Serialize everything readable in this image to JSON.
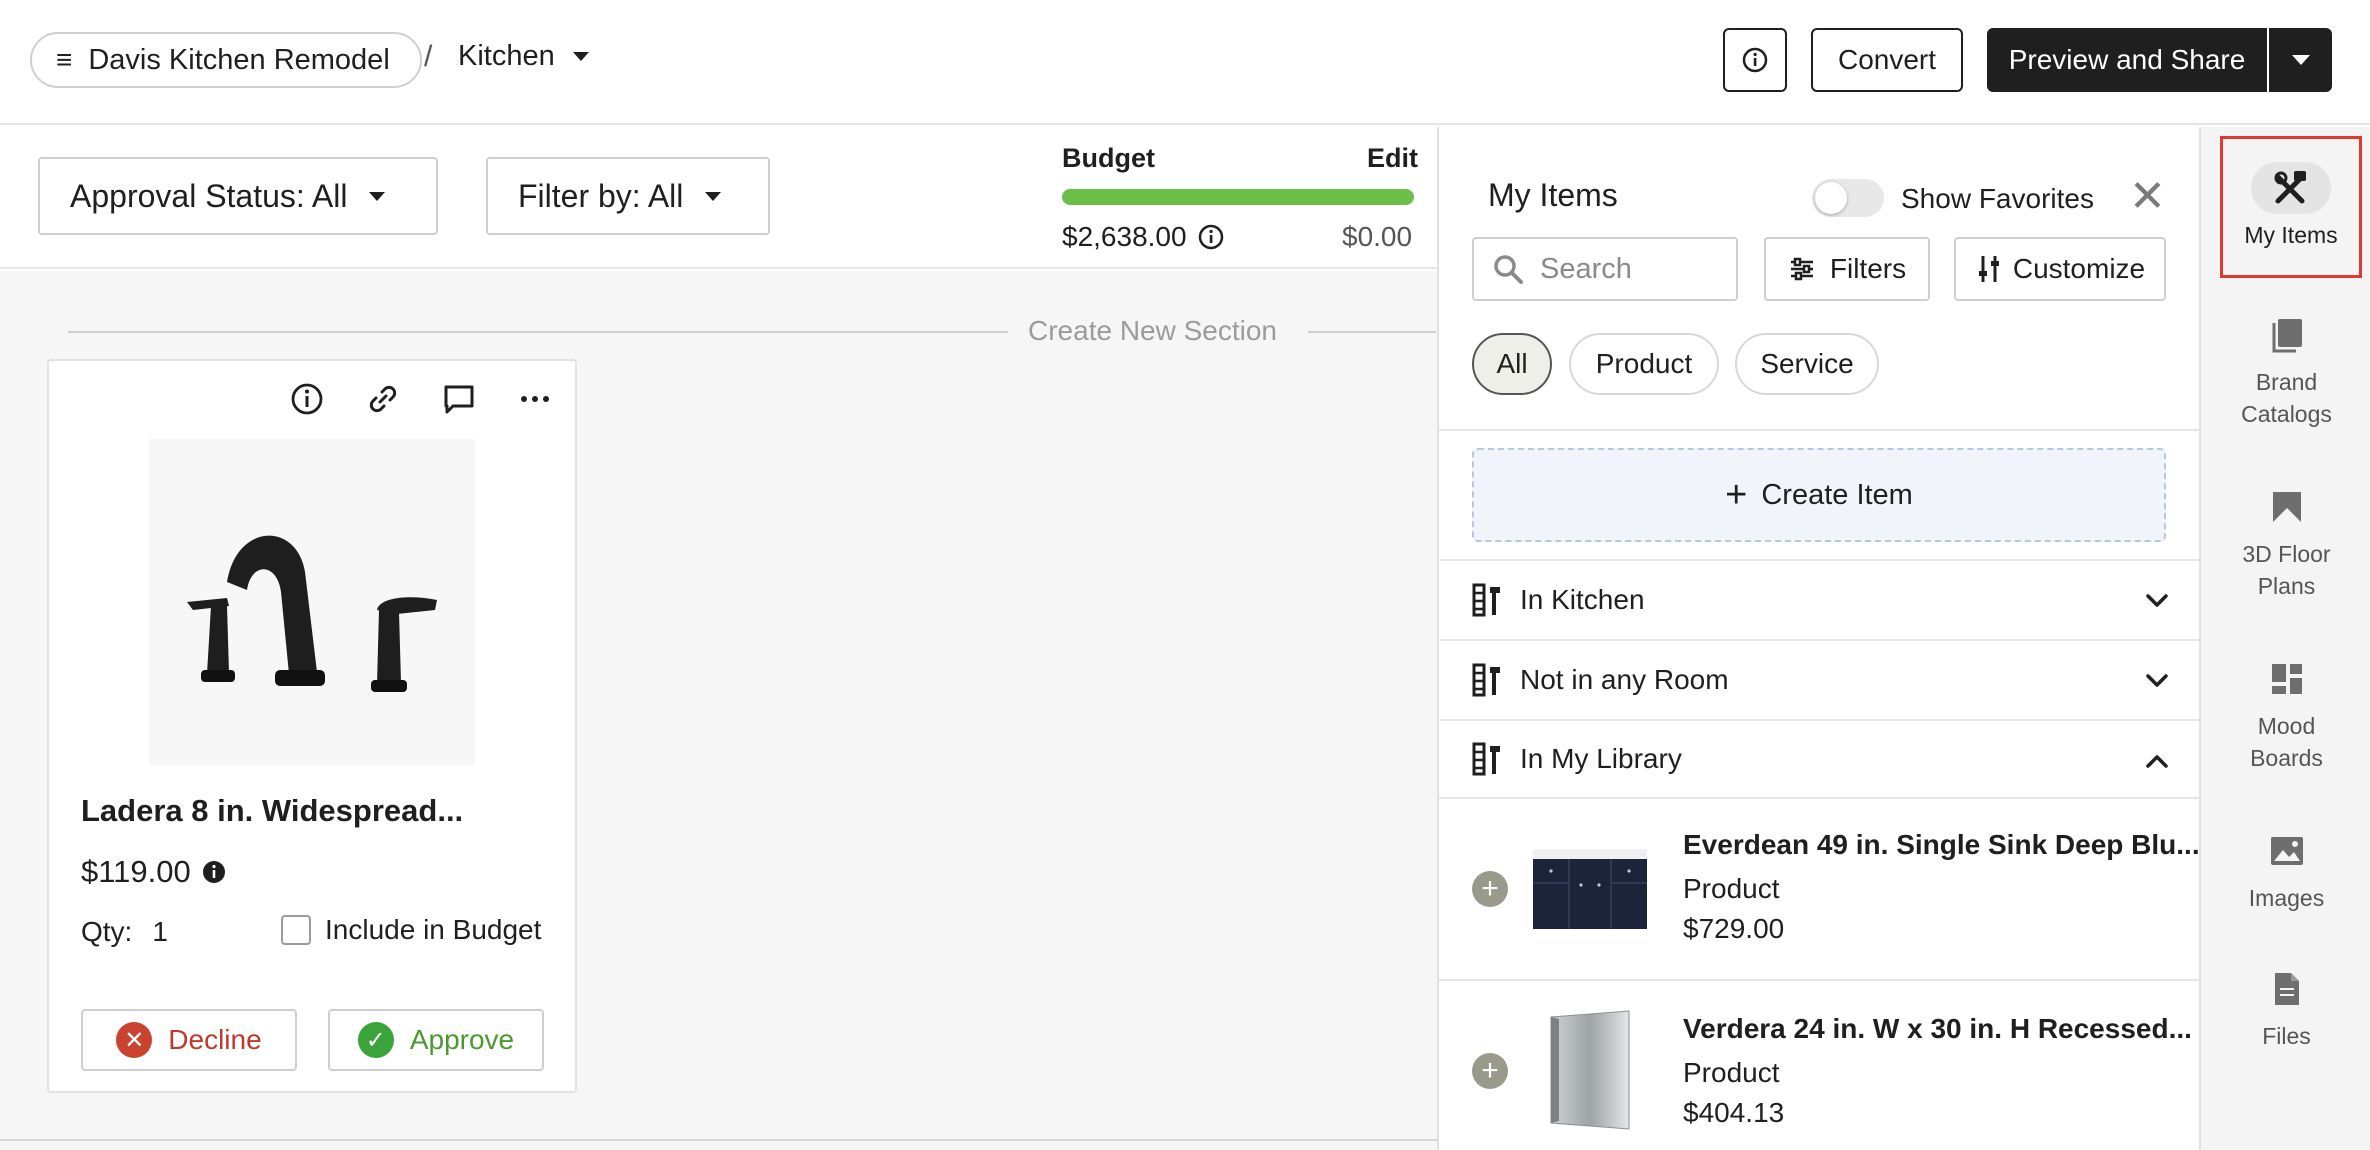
{
  "header": {
    "project_name": "Davis Kitchen Remodel",
    "breadcrumb_separator": "/",
    "room": "Kitchen",
    "convert_label": "Convert",
    "preview_label": "Preview and Share"
  },
  "filters": {
    "approval_status": "Approval Status: All",
    "filter_by": "Filter by: All"
  },
  "budget": {
    "label": "Budget",
    "edit_label": "Edit",
    "spent": "$2,638.00",
    "remaining": "$0.00",
    "bar_fill_fraction": 1.0,
    "bar_color": "#6cc04a"
  },
  "canvas": {
    "section_label": "Create New Section"
  },
  "card": {
    "title": "Ladera 8 in. Widespread...",
    "price": "$119.00",
    "qty_label": "Qty:",
    "qty_value": "1",
    "include_label": "Include in Budget",
    "decline_label": "Decline",
    "approve_label": "Approve",
    "icons": [
      "info-icon",
      "link-icon",
      "comment-icon",
      "more-icon"
    ]
  },
  "panel": {
    "title": "My Items",
    "show_favorites_label": "Show Favorites",
    "search_placeholder": "Search",
    "filters_label": "Filters",
    "customize_label": "Customize",
    "chips": [
      "All",
      "Product",
      "Service"
    ],
    "create_item_label": "Create Item",
    "groups": [
      {
        "label": "In Kitchen",
        "expanded": false
      },
      {
        "label": "Not in any Room",
        "expanded": false
      },
      {
        "label": "In My Library",
        "expanded": true
      }
    ],
    "library_items": [
      {
        "name": "Everdean 49 in. Single Sink Deep Blu...",
        "type": "Product",
        "price": "$729.00"
      },
      {
        "name": "Verdera 24 in. W x 30 in. H Recessed...",
        "type": "Product",
        "price": "$404.13"
      }
    ]
  },
  "rail": {
    "items": [
      {
        "label": "My Items",
        "icon": "tools-icon",
        "active": true
      },
      {
        "label": "Brand Catalogs",
        "icon": "catalog-icon",
        "active": false
      },
      {
        "label": "3D Floor Plans",
        "icon": "floorplan-icon",
        "active": false
      },
      {
        "label": "Mood Boards",
        "icon": "moodboard-icon",
        "active": false
      },
      {
        "label": "Images",
        "icon": "image-icon",
        "active": false
      },
      {
        "label": "Files",
        "icon": "file-icon",
        "active": false
      }
    ]
  },
  "colors": {
    "primary_dark": "#1f1f1f",
    "decline_red": "#c9432f",
    "approve_green": "#3aa33a",
    "highlight_red": "#e03a2e",
    "create_item_bg": "#f1f5fb"
  }
}
